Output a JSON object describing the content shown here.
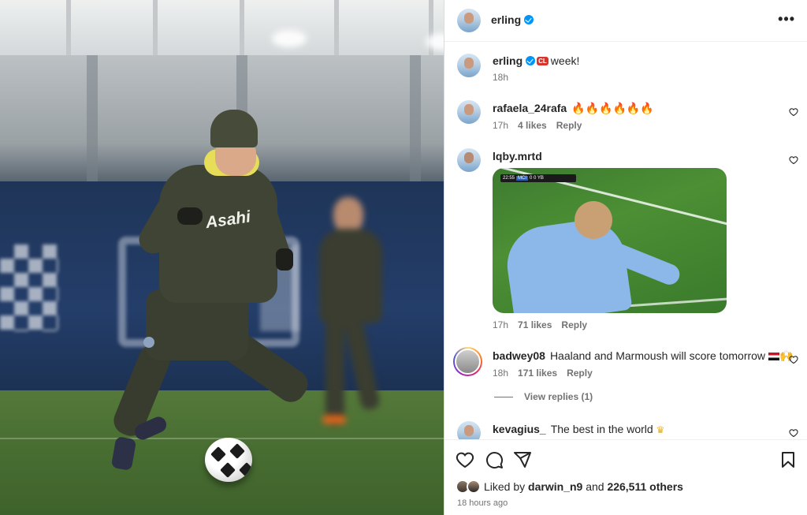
{
  "post": {
    "author": "erling",
    "caption_username": "erling",
    "caption_badge": "CL",
    "caption_text": "week!",
    "caption_time": "18h",
    "likes_prefix": "Liked by",
    "liked_by_user": "darwin_n9",
    "likes_joiner": "and",
    "likes_others": "226,511 others",
    "posted_ago": "18 hours ago"
  },
  "photo": {
    "sponsor_text": "Asahi"
  },
  "comments": [
    {
      "username": "rafaela_24rafa",
      "text": "🔥🔥🔥🔥🔥🔥",
      "time": "17h",
      "likes": "4 likes",
      "reply": "Reply"
    },
    {
      "username": "lqby.mrtd",
      "text": "",
      "time": "17h",
      "likes": "71 likes",
      "reply": "Reply",
      "gif_scoreboard": {
        "clock": "22:55",
        "home": "MCI",
        "score": "0 0",
        "away": "YB"
      }
    },
    {
      "username": "badwey08",
      "text": "Haaland and Marmoush will score tomorrow",
      "emoji": "🙌",
      "time": "18h",
      "likes": "171 likes",
      "reply": "Reply",
      "view_replies": "View replies (1)"
    },
    {
      "username": "kevagius_",
      "text": "The best in the world",
      "emoji": "♛"
    }
  ],
  "icons": {
    "more": "more-options-icon",
    "like": "heart-icon",
    "comment": "comment-icon",
    "share": "share-icon",
    "save": "bookmark-icon",
    "verified": "verified-badge-icon"
  },
  "colors": {
    "verified": "#0095f6",
    "secondary_text": "#737373",
    "border": "#dbdbdb"
  }
}
